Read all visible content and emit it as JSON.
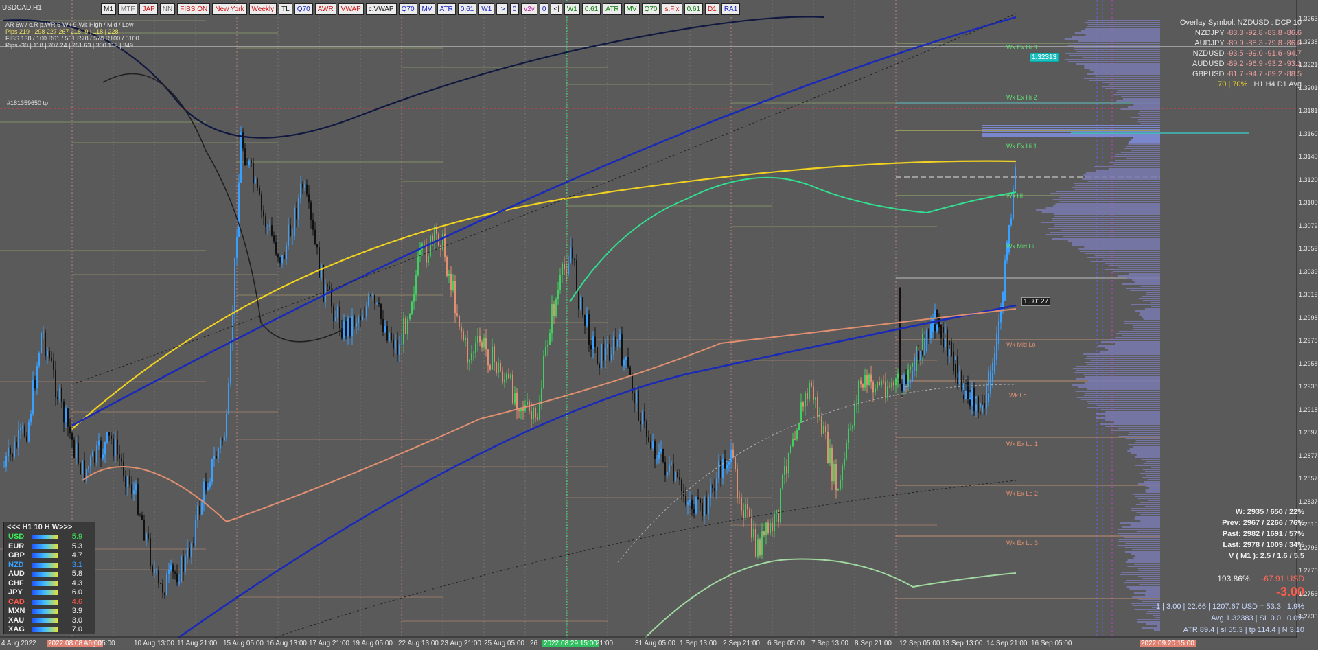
{
  "window": {
    "symbol_title": "USDCAD,H1"
  },
  "toolbar": [
    "M1",
    "MTF",
    "JAP",
    "NN",
    "FIBS ON",
    "New York",
    "Weekly",
    "TL",
    "Q70",
    "AWR",
    "VWAP",
    "c.VWAP",
    "Q70",
    "MV",
    "ATR",
    "0.61",
    "W1",
    "|>",
    "0",
    "v2v",
    "0",
    "<|",
    "W1",
    "0.61",
    "ATR",
    "MV",
    "Q70",
    "s.Fix",
    "0.61",
    "D1",
    "RA1"
  ],
  "top_left": {
    "hdr": "AR   6w / c.R   p.WR   6-Wk   9-Wk        High / Mid / Low",
    "pips_row1": "Pips   219 | 298   227   267   218         -9 | 118 | 228",
    "fibs_row": "FIBS 138 / 100   R61 / 561   R78 / 578   R100 / 5100",
    "pips_row2": "Pips   -30 | 118 | 207   24 | 261   63 | 300   112 | 349",
    "ticket": "#181359650 tp"
  },
  "overlay": {
    "title": "Overlay Symbol: NZDUSD : DCP 10",
    "rows": [
      {
        "sym": "NZDJPY",
        "vals": "-83.3  -92.8  -83.8  -86.6"
      },
      {
        "sym": "AUDJPY",
        "vals": "-89.9  -88.3  -79.8  -86.0"
      },
      {
        "sym": "NZDUSD",
        "vals": "-93.5  -99.0  -91.6  -94.7"
      },
      {
        "sym": "AUDUSD",
        "vals": "-89.2  -96.9  -93.2  -93.1"
      },
      {
        "sym": "GBPUSD",
        "vals": "-81.7  -94.7  -89.2  -88.5"
      }
    ],
    "footer_left": "70 | 70%",
    "footer_tfs": "H1    H4    D1    Avg"
  },
  "strength_panel": {
    "header": "<<<   H1  10  H   W>>>",
    "rows": [
      {
        "cur": "USD",
        "val": "5.9",
        "color": "#3ee85a"
      },
      {
        "cur": "EUR",
        "val": "5.3",
        "color": "#eeeeee"
      },
      {
        "cur": "GBP",
        "val": "4.7",
        "color": "#eeeeee"
      },
      {
        "cur": "NZD",
        "val": "3.1",
        "color": "#3aa0ff"
      },
      {
        "cur": "AUD",
        "val": "5.8",
        "color": "#eeeeee"
      },
      {
        "cur": "CHF",
        "val": "4.3",
        "color": "#eeeeee"
      },
      {
        "cur": "JPY",
        "val": "6.0",
        "color": "#eeeeee"
      },
      {
        "cur": "CAD",
        "val": "4.6",
        "color": "#ff5a4a"
      },
      {
        "cur": "MXN",
        "val": "3.9",
        "color": "#eeeeee"
      },
      {
        "cur": "XAU",
        "val": "3.0",
        "color": "#eeeeee"
      },
      {
        "cur": "XAG",
        "val": "7.0",
        "color": "#eeeeee"
      }
    ]
  },
  "stats": [
    "W: 2935 / 650 / 22%",
    "Prev: 2967 / 2266 / 76%",
    "Past: 2982 / 1691 / 57%",
    "Last: 2978 / 1009 / 34%",
    "V ( M1 ): 2.5 / 1.6 / 5.5"
  ],
  "pnl": {
    "pct": "193.86%",
    "usd": "-67.91 USD",
    "big": "-3.00"
  },
  "bottom_info": [
    "1  |  3.00  |  22.66  |  1207.67 USD = 53.3  |  1.9%",
    "Avg 1.32383  |  SL 0.0  |  0.0%",
    "ATR 89.4  |  sl 55.3  |  tp 114.4  |  N 3.10"
  ],
  "x_axis": [
    "4 Aug 2022",
    "2022.08.08 15:00",
    "Aug 05:00",
    "10 Aug 13:00",
    "11 Aug 21:00",
    "15 Aug 05:00",
    "16 Aug 13:00",
    "17 Aug 21:00",
    "19 Aug 05:00",
    "22 Aug 13:00",
    "23 Aug 21:00",
    "25 Aug 05:00",
    "26",
    "2022.08.29 15:00",
    "21:00",
    "31 Aug 05:00",
    "1 Sep 13:00",
    "2 Sep 21:00",
    "6 Sep 05:00",
    "7 Sep 13:00",
    "8 Sep 21:00",
    "12 Sep 05:00",
    "13 Sep 13:00",
    "14 Sep 21:00",
    "16 Sep 05:00",
    "2022.09.20 15:00"
  ],
  "y_axis": [
    "1.32635",
    "1.32383",
    "1.32210",
    "1.32010",
    "1.31810",
    "1.31605",
    "1.31405",
    "1.31200",
    "1.31000",
    "1.30795",
    "1.30595",
    "1.30390",
    "1.30190",
    "1.29985",
    "1.29785",
    "1.29580",
    "1.29380",
    "1.29180",
    "1.28975",
    "1.28775",
    "1.28570",
    "1.28370",
    "1.28165",
    "1.27965",
    "1.27760",
    "1.27560",
    "1.27355"
  ],
  "price_tags": {
    "current": "1.32313",
    "mid": "1.30127"
  },
  "level_labels": {
    "wk_ex_hi_3": "Wk Ex Hi 3",
    "wk_ex_hi_2": "Wk Ex Hi 2",
    "wk_ex_hi_1": "Wk Ex Hi 1",
    "wk_hi": "Wk Hi",
    "wk_mid_hi": "Wk Mid Hi",
    "wk_mid_lo": "Wk Mid Lo",
    "wk_lo": "Wk Lo",
    "wk_ex_lo_1": "Wk Ex Lo 1",
    "wk_ex_lo_2": "Wk Ex Lo 2",
    "wk_ex_lo_3": "Wk Ex Lo 3"
  },
  "colors": {
    "bg": "#5a5a5a",
    "up": "#3aa0ff",
    "down": "#111111",
    "green": "#40d060",
    "salmon": "#e09070",
    "yellow": "#f0d020",
    "blue": "#1a2ab8"
  }
}
